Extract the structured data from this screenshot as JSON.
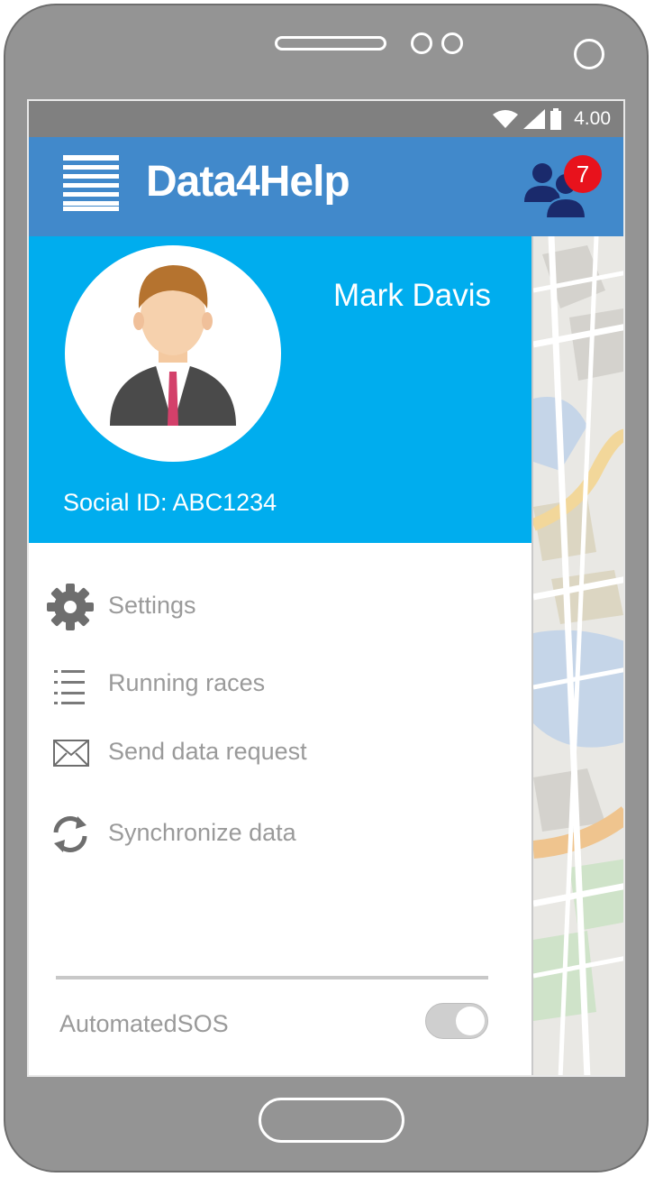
{
  "status_bar": {
    "time": "4.00"
  },
  "app_bar": {
    "title": "Data4Help",
    "notification_count": "7"
  },
  "profile": {
    "name": "Mark Davis",
    "social_id": "Social ID: ABC1234"
  },
  "menu": {
    "items": [
      {
        "label": "Settings",
        "icon": "gear-icon"
      },
      {
        "label": "Running races",
        "icon": "list-icon"
      },
      {
        "label": "Send data request",
        "icon": "envelope-icon"
      },
      {
        "label": "Synchronize data",
        "icon": "sync-icon"
      }
    ]
  },
  "automated_sos": {
    "label": "AutomatedSOS",
    "enabled": true
  },
  "colors": {
    "app_bar": "#4189cb",
    "profile_header": "#00adee",
    "badge": "#e8121c"
  }
}
